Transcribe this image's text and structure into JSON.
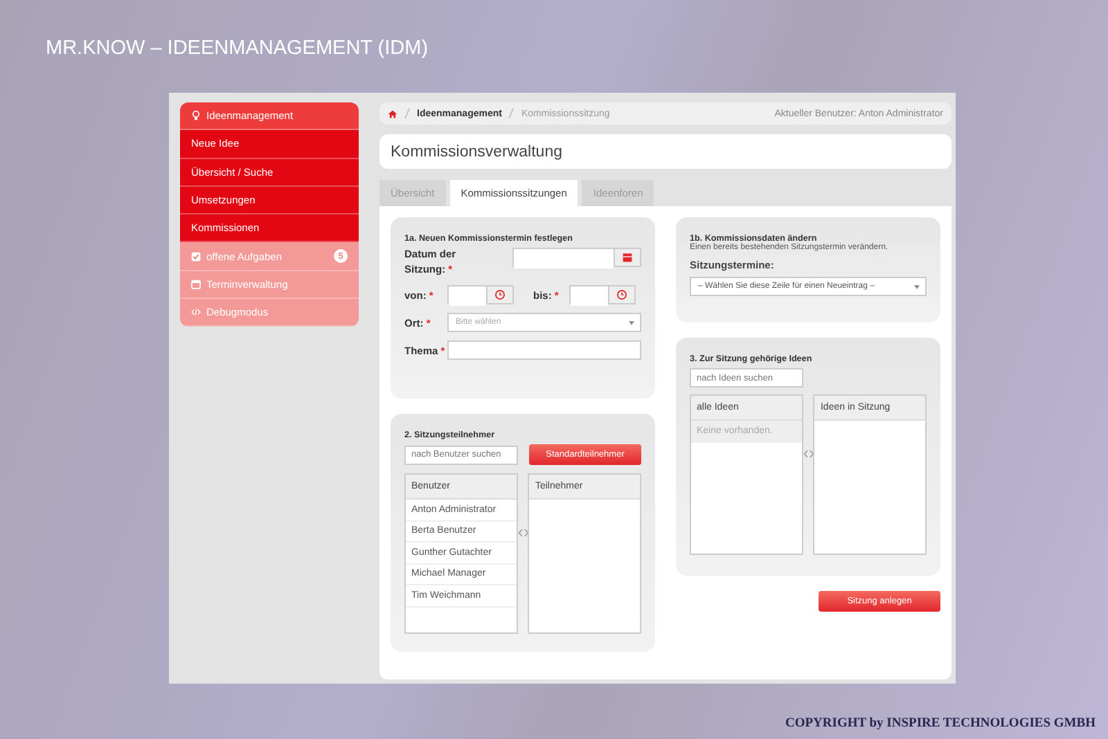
{
  "slide_title": "MR.KNOW – IDEENMANAGEMENT (IDM)",
  "sidebar": {
    "items": [
      {
        "label": "Ideenmanagement",
        "kind": "header"
      },
      {
        "label": "Neue Idee",
        "kind": "link"
      },
      {
        "label": "Übersicht / Suche",
        "kind": "link"
      },
      {
        "label": "Umsetzungen",
        "kind": "link"
      },
      {
        "label": "Kommissionen",
        "kind": "link"
      },
      {
        "label": "offene Aufgaben",
        "kind": "tool",
        "badge": "5"
      },
      {
        "label": "Terminverwaltung",
        "kind": "tool"
      },
      {
        "label": "Debugmodus",
        "kind": "tool"
      }
    ]
  },
  "breadcrumb": {
    "items": [
      "Ideenmanagement",
      "Kommissionssitzung"
    ],
    "user": "Aktueller Benutzer: Anton Administrator"
  },
  "page_title": "Kommissionsverwaltung",
  "tabs": [
    {
      "label": "Übersicht",
      "selected": false
    },
    {
      "label": "Kommissionssitzungen",
      "selected": true
    },
    {
      "label": "Ideenforen",
      "selected": false
    }
  ],
  "new_appointment": {
    "title": "1a. Neuen Kommissionstermin festlegen",
    "date": {
      "label": "Datum der Sitzung:",
      "mark": "*"
    },
    "from": {
      "label": "von:",
      "mark": "*"
    },
    "to": {
      "label": "bis:",
      "mark": "*"
    },
    "location": {
      "label": "Ort:",
      "mark": "*",
      "placeholder": "Bitte wählen"
    },
    "topic": {
      "label": "Thema",
      "mark": "*"
    }
  },
  "participants": {
    "title": "2. Sitzungsteilnehmer",
    "search": {
      "placeholder": "nach Benutzer suchen"
    },
    "button": "Standardteilnehmer",
    "users": {
      "heading": "Benutzer",
      "items": [
        "Anton Administrator",
        "Berta Benutzer",
        "Gunther Gutachter",
        "Michael Manager",
        "Tim Weichmann"
      ]
    },
    "members": {
      "heading": "Teilnehmer"
    }
  },
  "edit": {
    "title": "1b. Kommissionsdaten ändern",
    "hint": "Einen bereits bestehenden Sitzungstermin verändern.",
    "label": "Sitzungstermine:",
    "select": "– Wählen Sie diese Zeile für einen Neueintrag –"
  },
  "ideas": {
    "title": "3. Zur Sitzung gehörige Ideen",
    "search": {
      "placeholder": "nach Ideen suchen"
    },
    "all": {
      "heading": "alle Ideen",
      "empty": "Keine vorhanden."
    },
    "session": {
      "heading": "Ideen in Sitzung"
    }
  },
  "submit": "Sitzung anlegen",
  "copyright": "COPYRIGHT by INSPIRE TECHNOLOGIES GMBH"
}
